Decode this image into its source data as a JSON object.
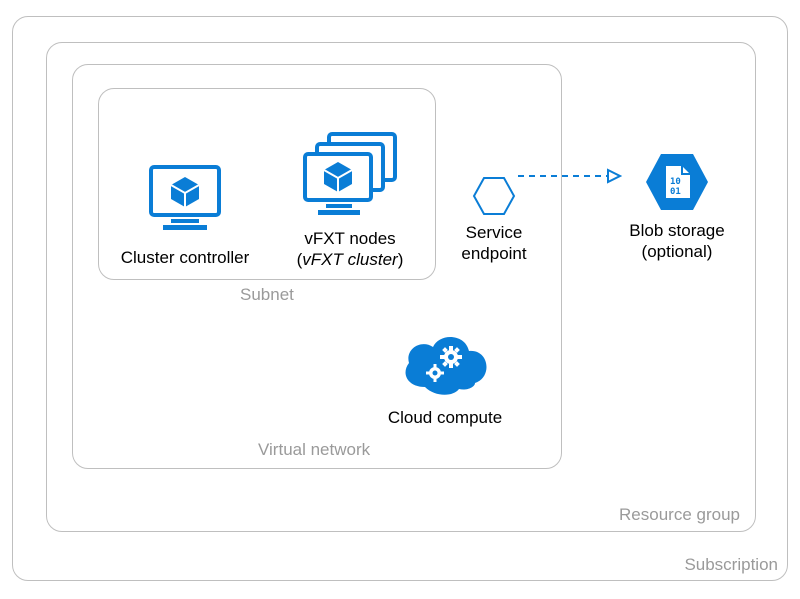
{
  "colors": {
    "azure": "#0a7dd6",
    "gray": "#bfbfbf",
    "labelGray": "#9a9a9a"
  },
  "boxes": {
    "subscription": {
      "label": "Subscription"
    },
    "resourceGroup": {
      "label": "Resource group"
    },
    "vnet": {
      "label": "Virtual network"
    },
    "subnet": {
      "label": "Subnet"
    }
  },
  "items": {
    "clusterController": {
      "label": "Cluster controller"
    },
    "vfxtNodes": {
      "line1": "vFXT nodes",
      "line2_pre": "(",
      "line2_em": "vFXT cluster",
      "line2_post": ")"
    },
    "serviceEndpoint": {
      "line1": "Service",
      "line2": "endpoint"
    },
    "blobStorage": {
      "line1": "Blob storage",
      "line2": "(optional)"
    },
    "cloudCompute": {
      "label": "Cloud compute"
    }
  }
}
